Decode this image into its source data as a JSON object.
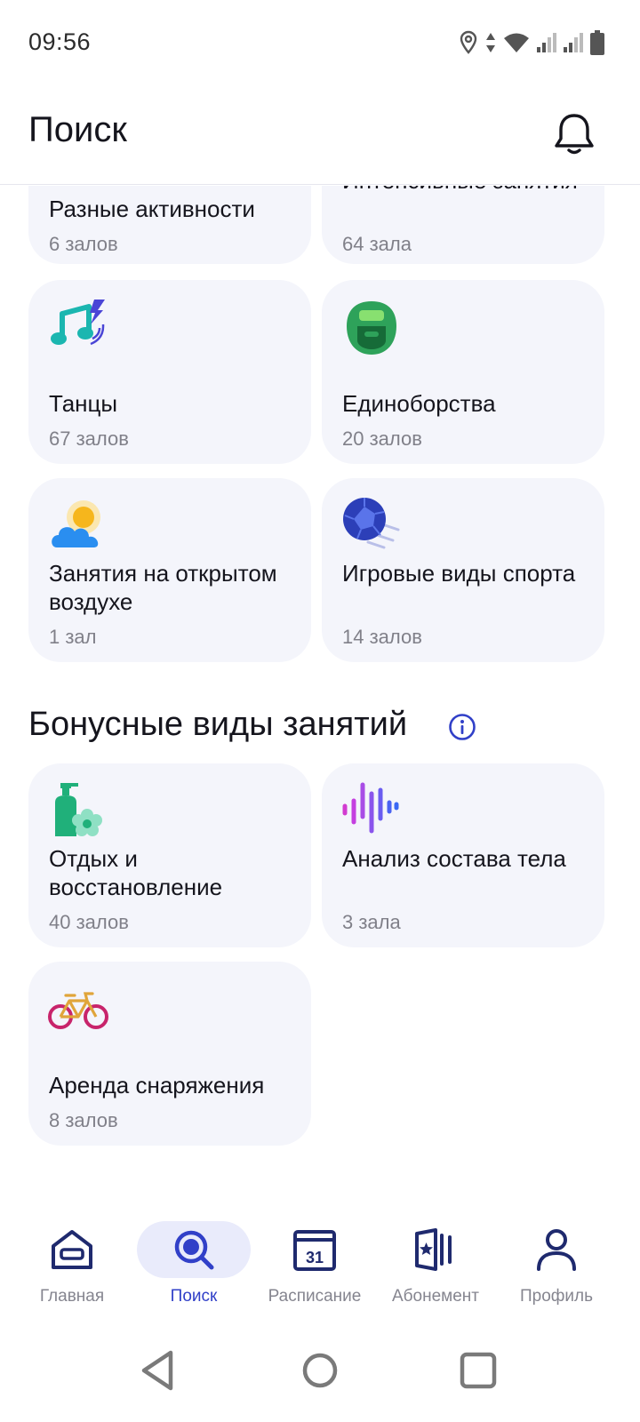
{
  "status_bar": {
    "time": "09:56"
  },
  "header": {
    "title": "Поиск"
  },
  "categories": [
    {
      "title": "Разные активности",
      "count": "6 залов",
      "icon": "mixed-activities-icon"
    },
    {
      "title": "Интенсивные занятия",
      "count": "64 зала",
      "icon": "intensive-training-icon"
    },
    {
      "title": "Танцы",
      "count": "67 залов",
      "icon": "music-notes-icon"
    },
    {
      "title": "Единоборства",
      "count": "20 залов",
      "icon": "boxing-helmet-icon"
    },
    {
      "title": "Занятия на открытом воздухе",
      "count": "1 зал",
      "icon": "sun-cloud-icon"
    },
    {
      "title": "Игровые виды спорта",
      "count": "14 залов",
      "icon": "ball-icon"
    }
  ],
  "bonus_section": {
    "title": "Бонусные виды занятий",
    "items": [
      {
        "title": "Отдых и восстановление",
        "count": "40 залов",
        "icon": "spa-bottle-icon"
      },
      {
        "title": "Анализ состава тела",
        "count": "3 зала",
        "icon": "sound-wave-icon"
      },
      {
        "title": "Аренда снаряжения",
        "count": "8 залов",
        "icon": "bicycle-icon"
      }
    ]
  },
  "bottom_nav": {
    "items": [
      {
        "label": "Главная",
        "icon": "home-icon"
      },
      {
        "label": "Поиск",
        "icon": "search-icon",
        "active": true
      },
      {
        "label": "Расписание",
        "icon": "calendar-icon",
        "calendar_day": "31"
      },
      {
        "label": "Абонемент",
        "icon": "membership-icon"
      },
      {
        "label": "Профиль",
        "icon": "profile-icon"
      }
    ]
  },
  "colors": {
    "accent": "#3140c8",
    "card_bg": "#f4f5fb",
    "muted_text": "#808089"
  }
}
